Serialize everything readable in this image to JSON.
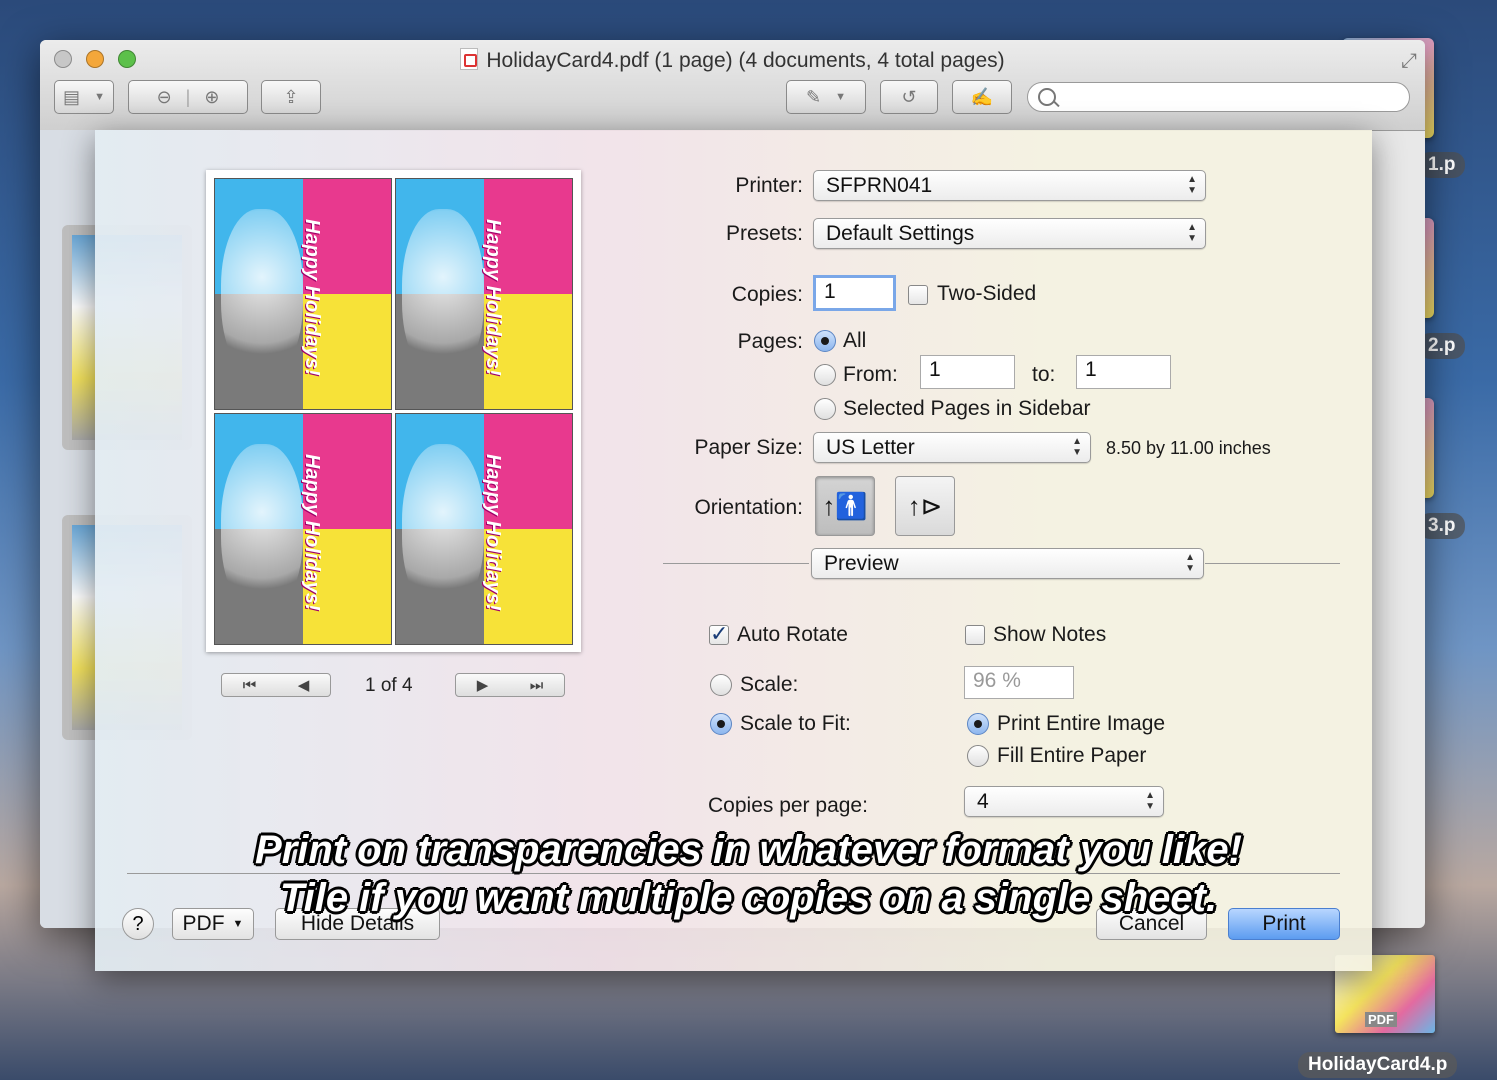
{
  "window": {
    "title": "HolidayCard4.pdf (1 page) (4 documents, 4 total pages)"
  },
  "desktop": {
    "labels": [
      "1.p",
      "2.p",
      "3.p"
    ],
    "file_label": "HolidayCard4.p",
    "file_badge": "PDF"
  },
  "print": {
    "printer_label": "Printer:",
    "printer_value": "SFPRN041",
    "presets_label": "Presets:",
    "presets_value": "Default Settings",
    "copies_label": "Copies:",
    "copies_value": "1",
    "two_sided_label": "Two-Sided",
    "pages_label": "Pages:",
    "pages_all": "All",
    "pages_from": "From:",
    "from_value": "1",
    "pages_to": "to:",
    "to_value": "1",
    "selected_pages": "Selected Pages in Sidebar",
    "paper_size_label": "Paper Size:",
    "paper_size_value": "US Letter",
    "paper_size_dims": "8.50 by 11.00 inches",
    "orientation_label": "Orientation:",
    "section_value": "Preview",
    "auto_rotate": "Auto Rotate",
    "show_notes": "Show Notes",
    "scale_label": "Scale:",
    "scale_value": "96 %",
    "scale_to_fit": "Scale to Fit:",
    "print_entire_image": "Print Entire Image",
    "fill_entire_paper": "Fill Entire Paper",
    "copies_per_page_label": "Copies per page:",
    "copies_per_page_value": "4",
    "pager": "1 of 4",
    "tile_text": "Happy Holidays!",
    "help": "?",
    "pdf_button": "PDF",
    "hide_details": "Hide Details",
    "cancel": "Cancel",
    "print_button": "Print"
  },
  "caption": {
    "line1": "Print on transparencies in whatever format you like!",
    "line2": "Tile if you want multiple copies on a single sheet."
  }
}
